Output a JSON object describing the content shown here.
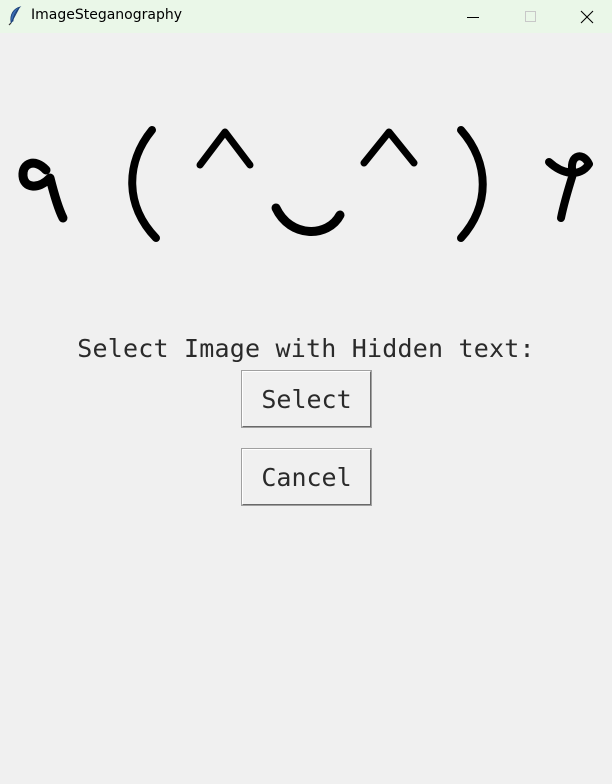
{
  "window": {
    "title": "ImageSteganography",
    "controls": {
      "minimize": "minimize-icon",
      "maximize": "maximize-icon",
      "close": "close-icon"
    },
    "app_icon": "feather-icon"
  },
  "banner": {
    "text": "٩ (^‿^) ۶"
  },
  "main": {
    "prompt_label": "Select Image with Hidden text:",
    "select_label": "Select",
    "cancel_label": "Cancel"
  },
  "colors": {
    "titlebar_bg": "#eaf7e8",
    "window_bg": "#f0f0f0",
    "text": "#2a2a2a"
  }
}
